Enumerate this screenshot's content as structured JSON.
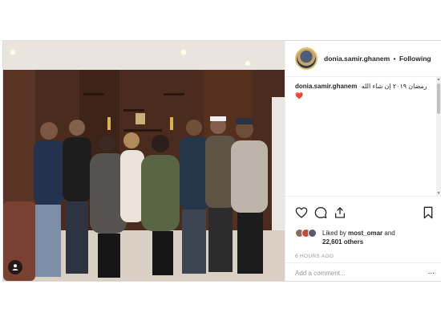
{
  "post": {
    "photo_alt": "Group photo",
    "header": {
      "username": "donia.samir.ghanem",
      "separator": "•",
      "follow_label": "Following"
    },
    "caption": {
      "username": "donia.samir.ghanem",
      "text": "رمضان ٢٠١٩ إن شاء الله",
      "emoji": "❤️"
    },
    "icons": {
      "like": "heart-icon",
      "comment": "comment-icon",
      "share": "share-icon",
      "save": "bookmark-icon"
    },
    "likes": {
      "prefix": "Liked by ",
      "user": "most_omar",
      "middle": " and",
      "count": "22,601 others"
    },
    "timestamp": "6 HOURS AGO",
    "comment": {
      "placeholder": "Add a comment...",
      "more": "..."
    },
    "colors": {
      "text": "#262626",
      "muted": "#999999",
      "border": "#dbdbdb"
    }
  }
}
